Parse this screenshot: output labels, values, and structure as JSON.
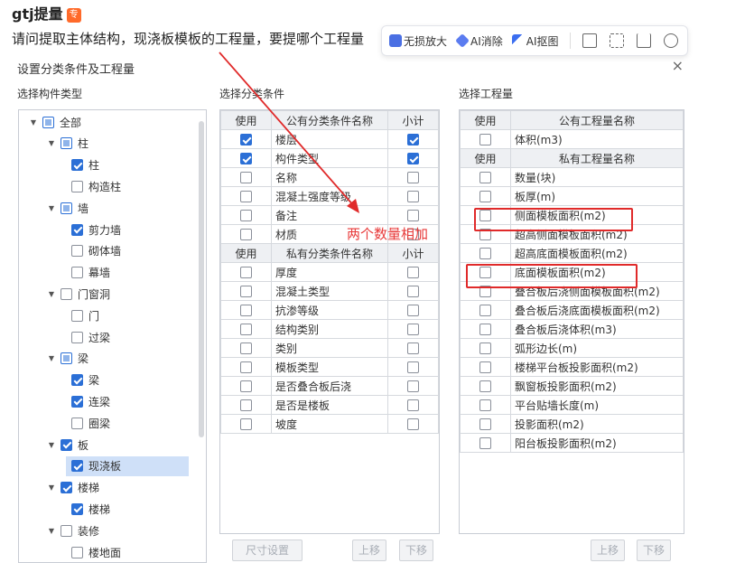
{
  "post": {
    "title": "gtj提量",
    "badge": "专",
    "question": "请问提取主体结构，现浇板模板的工程量，要提哪个工程量"
  },
  "toolbar": {
    "enlarge": "无损放大",
    "erase": "AI消除",
    "cutout": "AI抠图"
  },
  "dialog": {
    "title": "设置分类条件及工程量",
    "close": "×",
    "tree_label": "选择构件类型",
    "cond_label": "选择分类条件",
    "qty_label": "选择工程量",
    "tree": [
      {
        "label": "全部",
        "level": 0,
        "caret": "▼",
        "state": "partial"
      },
      {
        "label": "柱",
        "level": 1,
        "caret": "▼",
        "state": "partial"
      },
      {
        "label": "柱",
        "level": 2,
        "caret": "",
        "state": "checked"
      },
      {
        "label": "构造柱",
        "level": 2,
        "caret": "",
        "state": "unchecked"
      },
      {
        "label": "墙",
        "level": 1,
        "caret": "▼",
        "state": "partial"
      },
      {
        "label": "剪力墙",
        "level": 2,
        "caret": "",
        "state": "checked"
      },
      {
        "label": "砌体墙",
        "level": 2,
        "caret": "",
        "state": "unchecked"
      },
      {
        "label": "幕墙",
        "level": 2,
        "caret": "",
        "state": "unchecked"
      },
      {
        "label": "门窗洞",
        "level": 1,
        "caret": "▼",
        "state": "unchecked"
      },
      {
        "label": "门",
        "level": 2,
        "caret": "",
        "state": "unchecked"
      },
      {
        "label": "过梁",
        "level": 2,
        "caret": "",
        "state": "unchecked"
      },
      {
        "label": "梁",
        "level": 1,
        "caret": "▼",
        "state": "partial"
      },
      {
        "label": "梁",
        "level": 2,
        "caret": "",
        "state": "checked"
      },
      {
        "label": "连梁",
        "level": 2,
        "caret": "",
        "state": "checked"
      },
      {
        "label": "圈梁",
        "level": 2,
        "caret": "",
        "state": "unchecked"
      },
      {
        "label": "板",
        "level": 1,
        "caret": "▼",
        "state": "checked"
      },
      {
        "label": "现浇板",
        "level": 2,
        "caret": "",
        "state": "checked",
        "selected": true
      },
      {
        "label": "楼梯",
        "level": 1,
        "caret": "▼",
        "state": "checked"
      },
      {
        "label": "楼梯",
        "level": 2,
        "caret": "",
        "state": "checked"
      },
      {
        "label": "装修",
        "level": 1,
        "caret": "▼",
        "state": "unchecked"
      },
      {
        "label": "楼地面",
        "level": 2,
        "caret": "",
        "state": "unchecked"
      }
    ],
    "cond_public_header": {
      "use": "使用",
      "name": "公有分类条件名称",
      "subtotal": "小计"
    },
    "cond_public": [
      {
        "name": "楼层",
        "use": true,
        "subtotal": true
      },
      {
        "name": "构件类型",
        "use": true,
        "subtotal": true
      },
      {
        "name": "名称",
        "use": false,
        "subtotal": false
      },
      {
        "name": "混凝土强度等级",
        "use": false,
        "subtotal": false
      },
      {
        "name": "备注",
        "use": false,
        "subtotal": false
      },
      {
        "name": "材质",
        "use": false,
        "subtotal": false
      }
    ],
    "cond_private_header": {
      "use": "使用",
      "name": "私有分类条件名称",
      "subtotal": "小计"
    },
    "cond_private": [
      {
        "name": "厚度",
        "use": false,
        "subtotal": false
      },
      {
        "name": "混凝土类型",
        "use": false,
        "subtotal": false
      },
      {
        "name": "抗渗等级",
        "use": false,
        "subtotal": false
      },
      {
        "name": "结构类别",
        "use": false,
        "subtotal": false
      },
      {
        "name": "类别",
        "use": false,
        "subtotal": false
      },
      {
        "name": "模板类型",
        "use": false,
        "subtotal": false
      },
      {
        "name": "是否叠合板后浇",
        "use": false,
        "subtotal": false
      },
      {
        "name": "是否是楼板",
        "use": false,
        "subtotal": false
      },
      {
        "name": "坡度",
        "use": false,
        "subtotal": false
      }
    ],
    "qty_public_header": {
      "use": "使用",
      "name": "公有工程量名称"
    },
    "qty_public": [
      {
        "name": "体积(m3)",
        "use": false
      }
    ],
    "qty_private_header": {
      "use": "使用",
      "name": "私有工程量名称"
    },
    "qty_private": [
      {
        "name": "数量(块)",
        "use": false
      },
      {
        "name": "板厚(m)",
        "use": false
      },
      {
        "name": "侧面模板面积(m2)",
        "use": false
      },
      {
        "name": "超高侧面模板面积(m2)",
        "use": false
      },
      {
        "name": "超高底面模板面积(m2)",
        "use": false
      },
      {
        "name": "底面模板面积(m2)",
        "use": false
      },
      {
        "name": "叠合板后浇侧面模板面积(m2)",
        "use": false
      },
      {
        "name": "叠合板后浇底面模板面积(m2)",
        "use": false
      },
      {
        "name": "叠合板后浇体积(m3)",
        "use": false
      },
      {
        "name": "弧形边长(m)",
        "use": false
      },
      {
        "name": "楼梯平台板投影面积(m2)",
        "use": false
      },
      {
        "name": "飘窗板投影面积(m2)",
        "use": false
      },
      {
        "name": "平台贴墙长度(m)",
        "use": false
      },
      {
        "name": "投影面积(m2)",
        "use": false
      },
      {
        "name": "阳台板投影面积(m2)",
        "use": false
      }
    ],
    "buttons": {
      "size_setting": "尺寸设置",
      "move_up": "上移",
      "move_down": "下移",
      "qty_move_up": "上移",
      "qty_move_down": "下移"
    }
  },
  "annotation": {
    "text": "两个数量相加",
    "color": "#e02a2a"
  }
}
